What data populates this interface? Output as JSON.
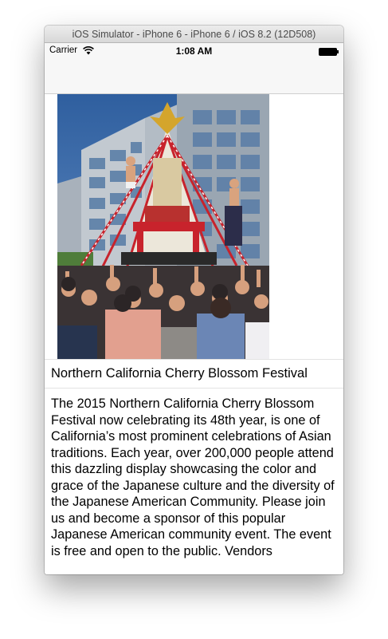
{
  "window": {
    "title": "iOS Simulator - iPhone 6 - iPhone 6 / iOS 8.2 (12D508)"
  },
  "status_bar": {
    "carrier": "Carrier",
    "time": "1:08 AM",
    "wifi_icon": "wifi-icon",
    "battery_icon": "battery-icon"
  },
  "event": {
    "image_description_icon": "festival-photo",
    "title": "Northern California Cherry Blossom Festival",
    "description": "The 2015 Northern California Cherry Blossom Festival now celebrating its 48th year, is one of California’s most prominent celebrations of Asian traditions. Each year, over 200,000 people attend this dazzling display showcasing the color and grace of the Japanese culture and the diversity of the Japanese American Community. Please join us and become a sponsor of this popular Japanese American community event. The event is free and open to the public. Vendors"
  },
  "colors": {
    "sky": "#3f6fae",
    "building": "#b9c0c8",
    "shrine_red": "#c8232c",
    "navbar": "#f7f7f7"
  }
}
